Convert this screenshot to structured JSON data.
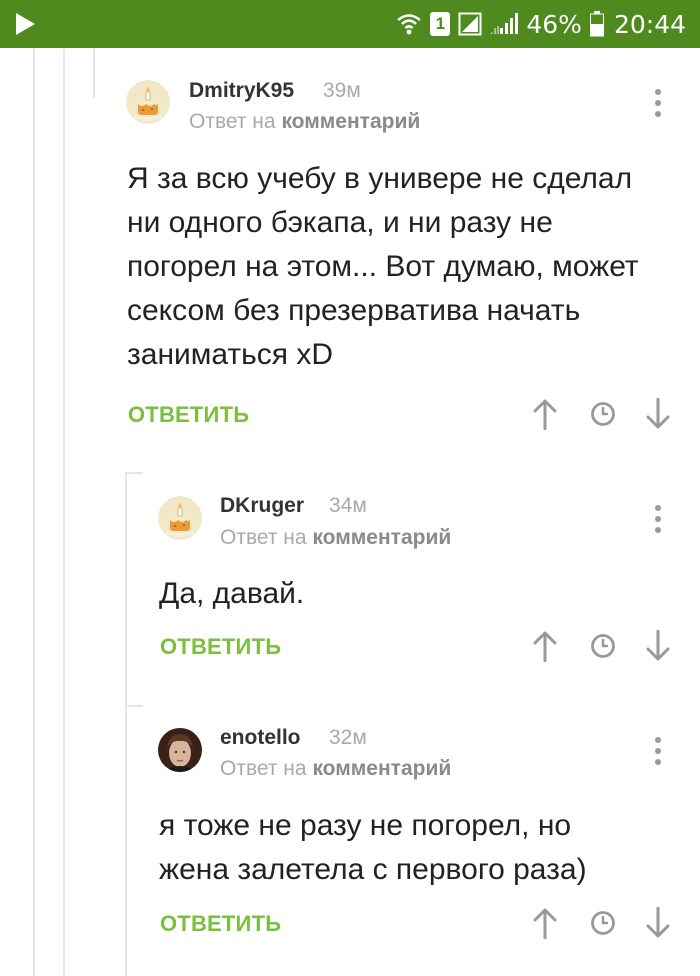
{
  "status_bar": {
    "sim_slot": "1",
    "battery_percent": "46%",
    "time": "20:44"
  },
  "comments": [
    {
      "username": "DmitryK95",
      "age": "39м",
      "reply_prefix": "Ответ на",
      "reply_target": "комментарий",
      "lines": [
        "Я за всю учебу в универе не сделал",
        "ни одного бэкапа, и ни разу не",
        "погорел на этом... Вот думаю, может",
        "сексом без презерватива начать",
        "заниматься xD"
      ],
      "reply_label": "ОТВЕТИТЬ"
    },
    {
      "username": "DKruger",
      "age": "34м",
      "reply_prefix": "Ответ на",
      "reply_target": "комментарий",
      "lines": [
        "Да, давай."
      ],
      "reply_label": "ОТВЕТИТЬ"
    },
    {
      "username": "enotello",
      "age": "32м",
      "reply_prefix": "Ответ на",
      "reply_target": "комментарий",
      "lines": [
        "я тоже не разу не погорел, но",
        "жена залетела с первого раза)"
      ],
      "reply_label": "ОТВЕТИТЬ"
    }
  ],
  "icons": {
    "upvote": "arrow-up-icon",
    "time": "clock-icon",
    "downvote": "arrow-down-icon",
    "more": "more-vertical-icon",
    "default_avatar": "cake-avatar-icon"
  }
}
